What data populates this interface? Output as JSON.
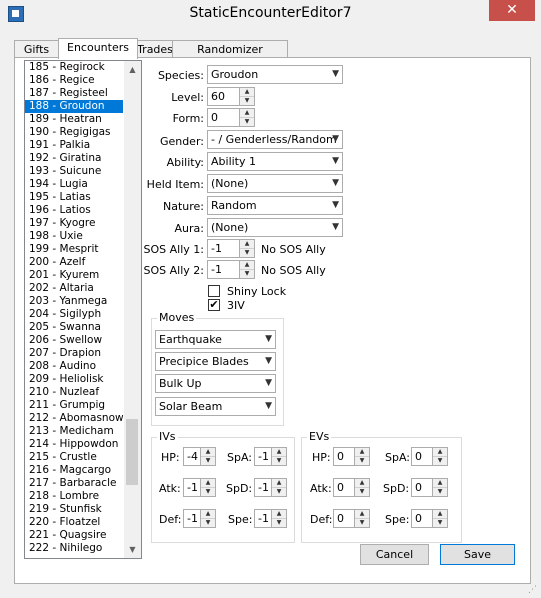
{
  "window": {
    "title": "StaticEncounterEditor7",
    "close": "✕"
  },
  "tabs": [
    "Gifts",
    "Encounters",
    "Trades",
    "Randomizer Options"
  ],
  "encounters": [
    "185 - Regirock",
    "186 - Regice",
    "187 - Registeel",
    "188 - Groudon",
    "189 - Heatran",
    "190 - Regigigas",
    "191 - Palkia",
    "192 - Giratina",
    "193 - Suicune",
    "194 - Lugia",
    "195 - Latias",
    "196 - Latios",
    "197 - Kyogre",
    "198 - Uxie",
    "199 - Mesprit",
    "200 - Azelf",
    "201 - Kyurem",
    "202 - Altaria",
    "203 - Yanmega",
    "204 - Sigilyph",
    "205 - Swanna",
    "206 - Swellow",
    "207 - Drapion",
    "208 - Audino",
    "209 - Heliolisk",
    "210 - Nuzleaf",
    "211 - Grumpig",
    "212 - Abomasnow",
    "213 - Medicham",
    "214 - Hippowdon",
    "215 - Crustle",
    "216 - Magcargo",
    "217 - Barbaracle",
    "218 - Lombre",
    "219 - Stunfisk",
    "220 - Floatzel",
    "221 - Quagsire",
    "222 - Nihilego"
  ],
  "selected_index": 3,
  "fields": {
    "species": {
      "label": "Species:",
      "value": "Groudon"
    },
    "level": {
      "label": "Level:",
      "value": "60"
    },
    "form": {
      "label": "Form:",
      "value": "0"
    },
    "gender": {
      "label": "Gender:",
      "value": "- / Genderless/Random"
    },
    "ability": {
      "label": "Ability:",
      "value": "Ability 1"
    },
    "held_item": {
      "label": "Held Item:",
      "value": "(None)"
    },
    "nature": {
      "label": "Nature:",
      "value": "Random"
    },
    "aura": {
      "label": "Aura:",
      "value": "(None)"
    },
    "sos1": {
      "label": "SOS Ally 1:",
      "value": "-1",
      "desc": "No SOS Ally"
    },
    "sos2": {
      "label": "SOS Ally 2:",
      "value": "-1",
      "desc": "No SOS Ally"
    },
    "shiny_lock": {
      "label": "Shiny Lock",
      "checked": false
    },
    "three_iv": {
      "label": "3IV",
      "checked": true
    }
  },
  "moves": {
    "title": "Moves",
    "items": [
      "Earthquake",
      "Precipice Blades",
      "Bulk Up",
      "Solar Beam"
    ]
  },
  "ivs": {
    "title": "IVs",
    "hp": {
      "label": "HP:",
      "value": "-4"
    },
    "atk": {
      "label": "Atk:",
      "value": "-1"
    },
    "def": {
      "label": "Def:",
      "value": "-1"
    },
    "spa": {
      "label": "SpA:",
      "value": "-1"
    },
    "spd": {
      "label": "SpD:",
      "value": "-1"
    },
    "spe": {
      "label": "Spe:",
      "value": "-1"
    }
  },
  "evs": {
    "title": "EVs",
    "hp": {
      "label": "HP:",
      "value": "0"
    },
    "atk": {
      "label": "Atk:",
      "value": "0"
    },
    "def": {
      "label": "Def:",
      "value": "0"
    },
    "spa": {
      "label": "SpA:",
      "value": "0"
    },
    "spd": {
      "label": "SpD:",
      "value": "0"
    },
    "spe": {
      "label": "Spe:",
      "value": "0"
    }
  },
  "buttons": {
    "cancel": "Cancel",
    "save": "Save"
  },
  "glyphs": {
    "dropdown": "▼",
    "up": "▲",
    "down": "▼",
    "check": "✔",
    "scroll_up": "▲",
    "scroll_down": "▼"
  }
}
